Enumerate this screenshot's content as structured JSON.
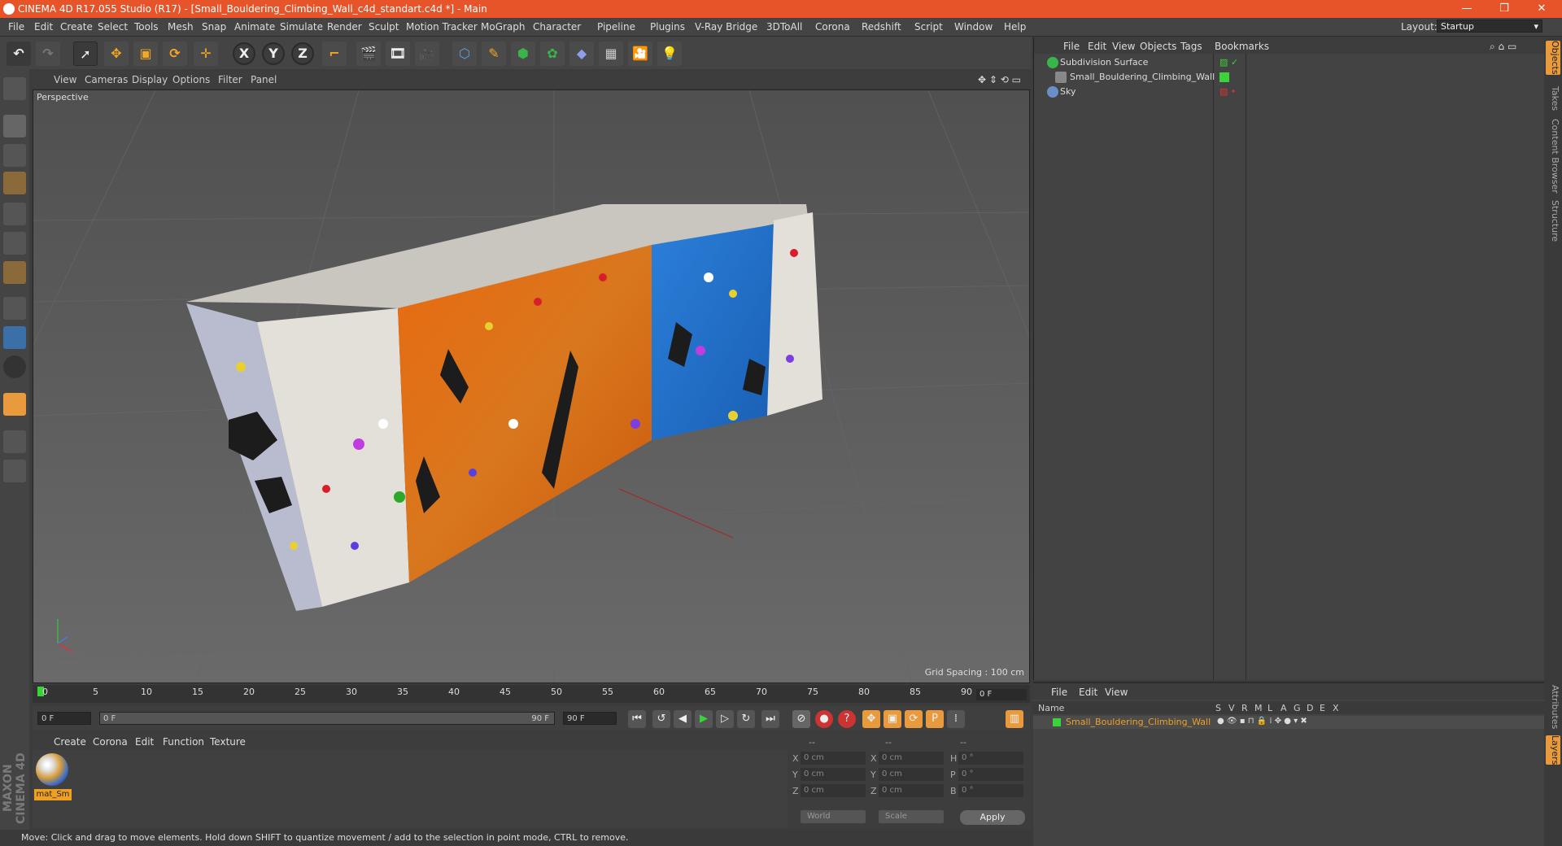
{
  "window": {
    "title": "CINEMA 4D R17.055 Studio (R17) - [Small_Bouldering_Climbing_Wall_c4d_standart.c4d *] - Main",
    "minimize": "—",
    "restore": "❐",
    "close": "✕"
  },
  "menubar": {
    "items": [
      "File",
      "Edit",
      "Create",
      "Select",
      "Tools",
      "Mesh",
      "Snap",
      "Animate",
      "Simulate",
      "Render",
      "Sculpt",
      "Motion Tracker",
      "MoGraph",
      "Character",
      "Pipeline",
      "Plugins",
      "V-Ray Bridge",
      "3DToAll",
      "Corona",
      "Redshift",
      "Script",
      "Window",
      "Help"
    ],
    "layout_label": "Layout:",
    "layout_value": "Startup"
  },
  "toolbar": {
    "axis_x": "X",
    "axis_y": "Y",
    "axis_z": "Z"
  },
  "viewport": {
    "menu": [
      "View",
      "Cameras",
      "Display",
      "Options",
      "Filter",
      "Panel"
    ],
    "camera_label": "Perspective",
    "grid_spacing": "Grid Spacing : 100 cm"
  },
  "timeline": {
    "ticks": [
      "0",
      "5",
      "10",
      "15",
      "20",
      "25",
      "30",
      "35",
      "40",
      "45",
      "50",
      "55",
      "60",
      "65",
      "70",
      "75",
      "80",
      "85",
      "90"
    ],
    "current_frame": "0 F",
    "start_field": "0 F",
    "range_left": "0 F",
    "range_right": "90 F",
    "end_field": "90 F"
  },
  "material_manager": {
    "menu": [
      "Create",
      "Corona",
      "Edit",
      "Function",
      "Texture"
    ],
    "material_name": "mat_Sm"
  },
  "coordinates": {
    "header": [
      "--",
      "--",
      "--"
    ],
    "rows": [
      {
        "l1": "X",
        "v1": "0 cm",
        "l2": "X",
        "v2": "0 cm",
        "l3": "H",
        "v3": "0 °"
      },
      {
        "l1": "Y",
        "v1": "0 cm",
        "l2": "Y",
        "v2": "0 cm",
        "l3": "P",
        "v3": "0 °"
      },
      {
        "l1": "Z",
        "v1": "0 cm",
        "l2": "Z",
        "v2": "0 cm",
        "l3": "B",
        "v3": "0 °"
      }
    ],
    "mode": "World",
    "transform": "Scale",
    "apply": "Apply"
  },
  "status": "Move: Click and drag to move elements. Hold down SHIFT to quantize movement / add to the selection in point mode, CTRL to remove.",
  "object_manager": {
    "menu": [
      "File",
      "Edit",
      "View",
      "Objects",
      "Tags",
      "Bookmarks"
    ],
    "objects": [
      {
        "name": "Subdivision Surface",
        "color": "#39b54a"
      },
      {
        "name": "Small_Bouldering_Climbing_Wall",
        "color": "#888888"
      },
      {
        "name": "Sky",
        "color": "#6a8fc8"
      }
    ]
  },
  "layer_manager": {
    "menu": [
      "File",
      "Edit",
      "View"
    ],
    "columns": [
      "Name",
      "S",
      "V",
      "R",
      "M",
      "L",
      "A",
      "G",
      "D",
      "E",
      "X"
    ],
    "layer_name": "Small_Bouldering_Climbing_Wall"
  },
  "right_tabs": [
    "Objects",
    "Takes",
    "Content Browser",
    "Structure",
    "Attributes",
    "Layers"
  ],
  "brand": "MAXON CINEMA 4D"
}
